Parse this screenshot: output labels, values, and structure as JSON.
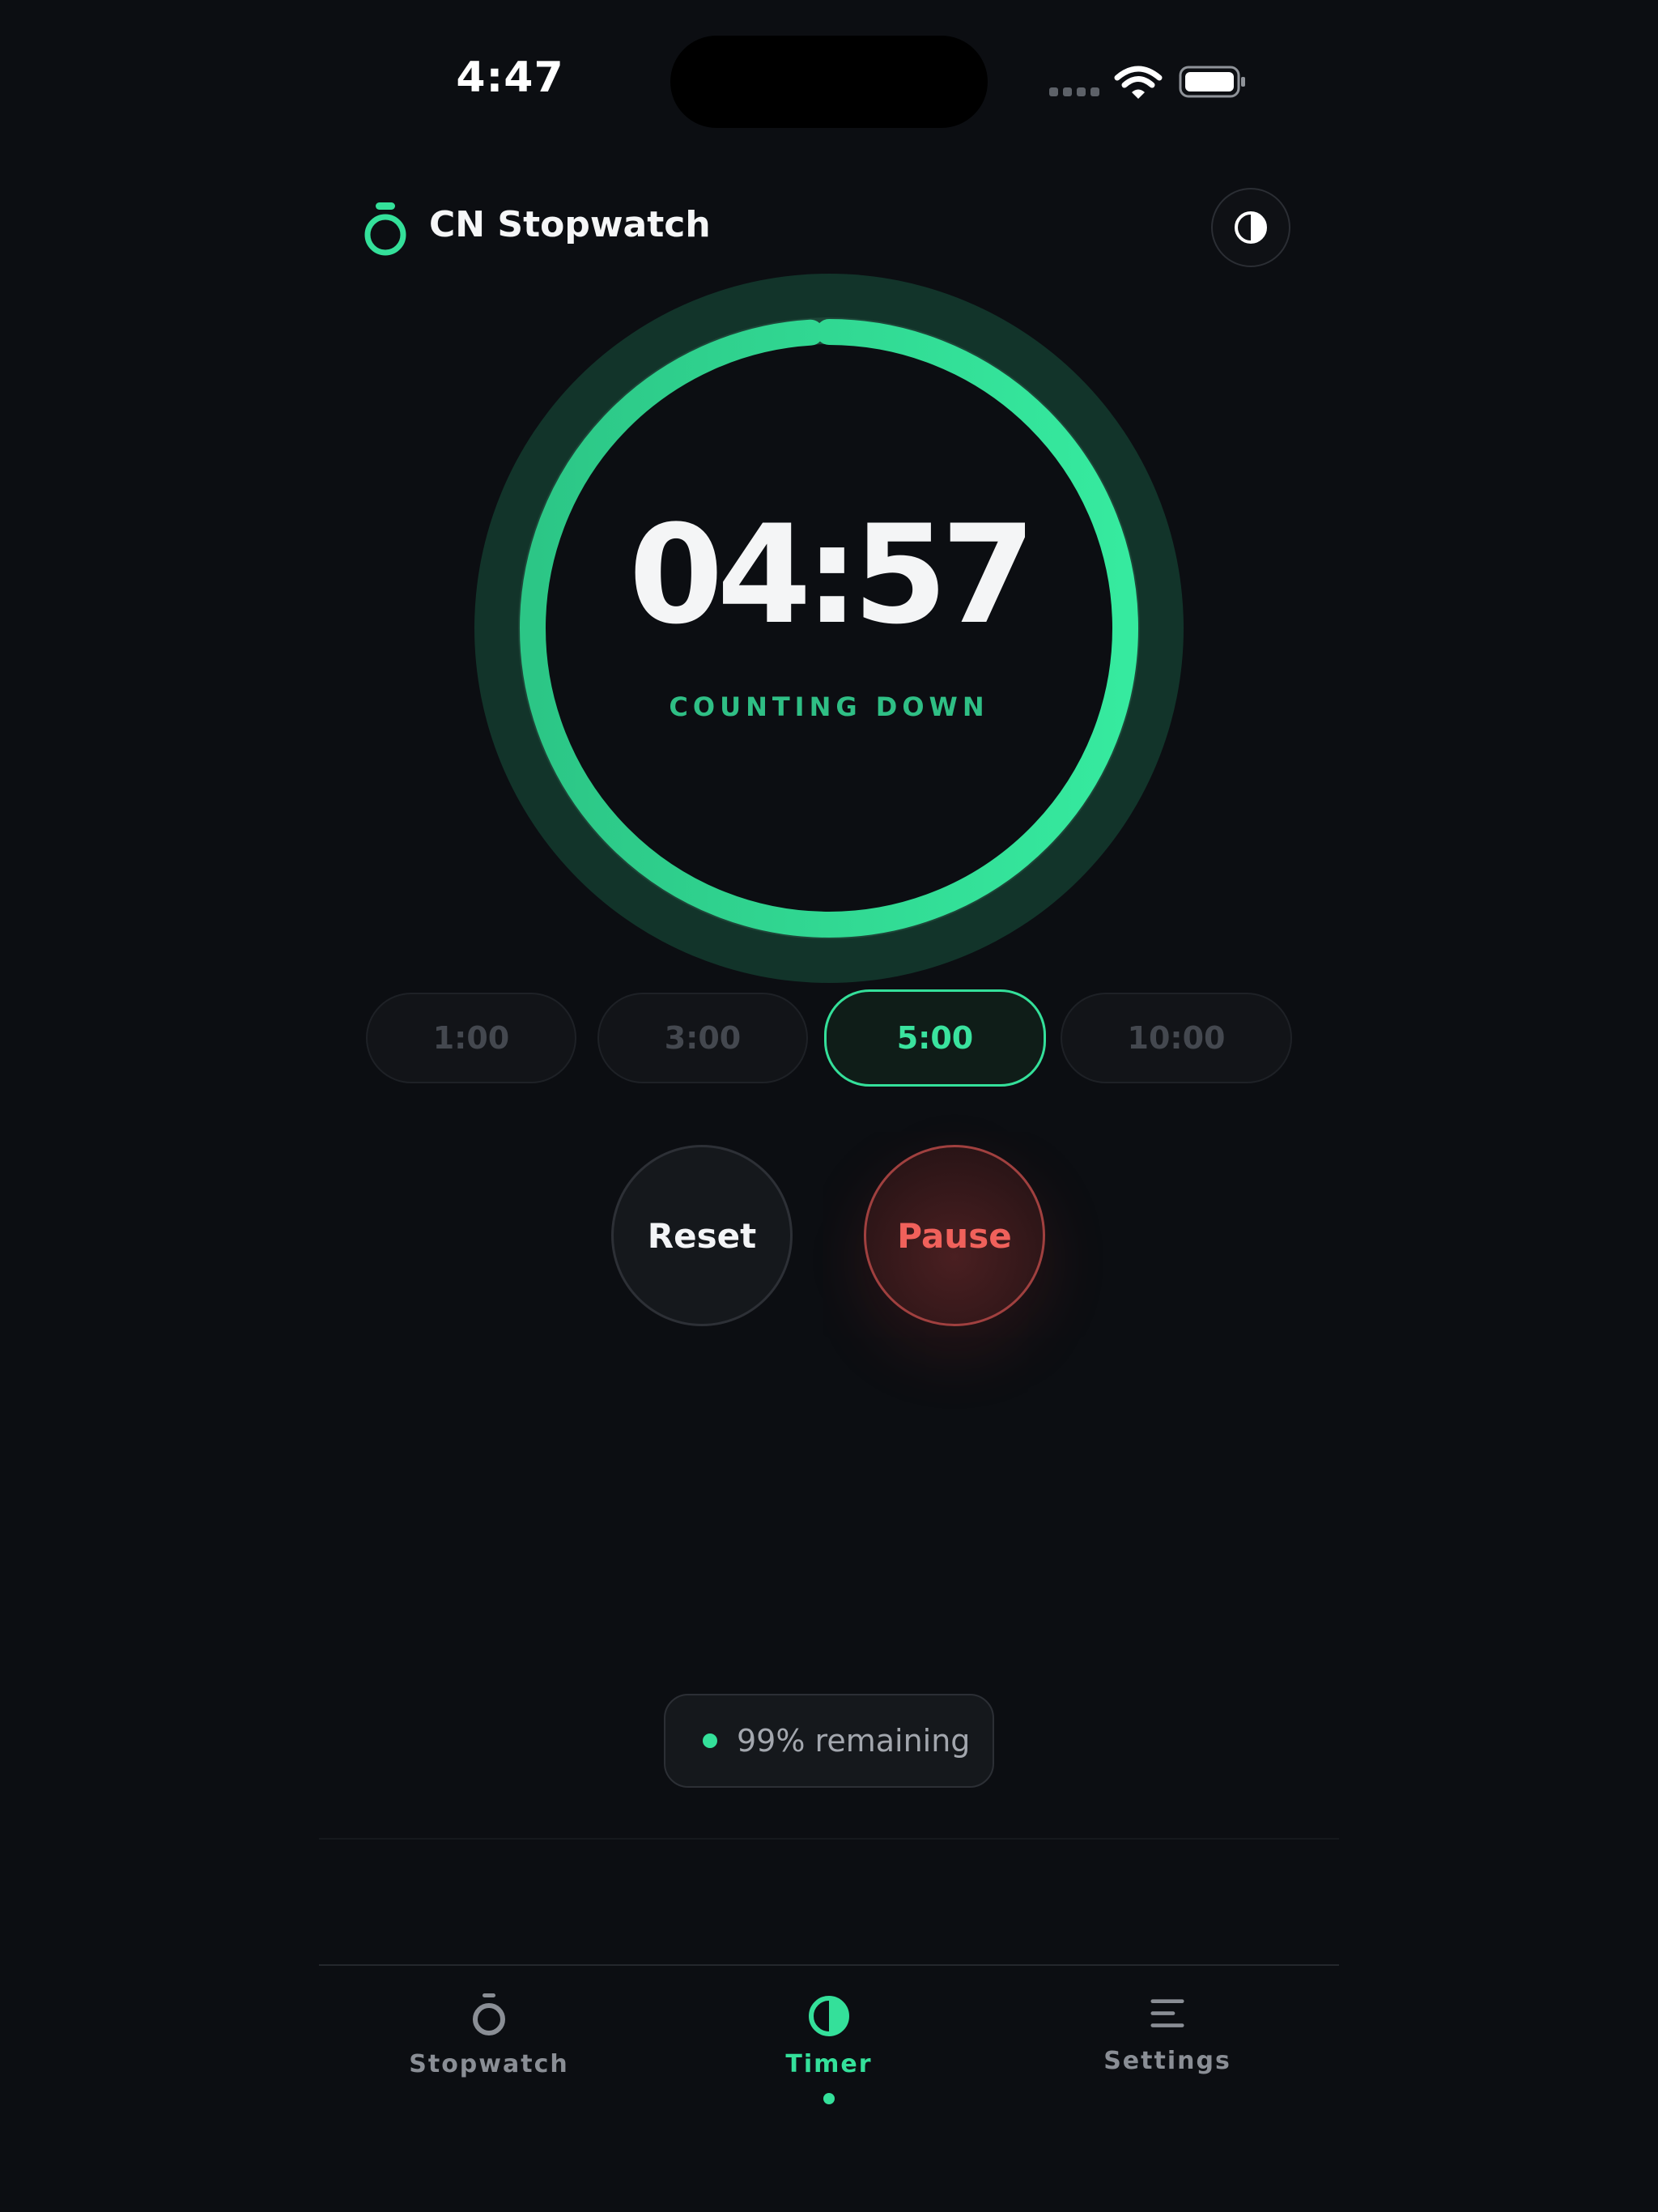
{
  "status_bar": {
    "time": "4:47",
    "signal_icon": "cellular-signal-icon",
    "wifi_icon": "wifi-icon",
    "battery_icon": "battery-icon"
  },
  "header": {
    "logo_icon": "stopwatch-icon",
    "title": "CN Stopwatch",
    "theme_toggle_icon": "contrast-icon"
  },
  "timer": {
    "display": "04:57",
    "status": "COUNTING DOWN",
    "progress_remaining": 0.99
  },
  "presets": [
    {
      "label": "1:00",
      "active": false
    },
    {
      "label": "3:00",
      "active": false
    },
    {
      "label": "5:00",
      "active": true
    },
    {
      "label": "10:00",
      "active": false
    }
  ],
  "controls": {
    "reset_label": "Reset",
    "pause_label": "Pause"
  },
  "remaining": {
    "text": "99% remaining"
  },
  "tabbar": {
    "items": [
      {
        "label": "Stopwatch",
        "icon": "stopwatch-icon",
        "active": false
      },
      {
        "label": "Timer",
        "icon": "timer-icon",
        "active": true
      },
      {
        "label": "Settings",
        "icon": "settings-icon",
        "active": false
      }
    ]
  },
  "colors": {
    "background": "#0c0e12",
    "accent": "#34e09a",
    "danger": "#f0615b",
    "ring_track": "#133326"
  }
}
